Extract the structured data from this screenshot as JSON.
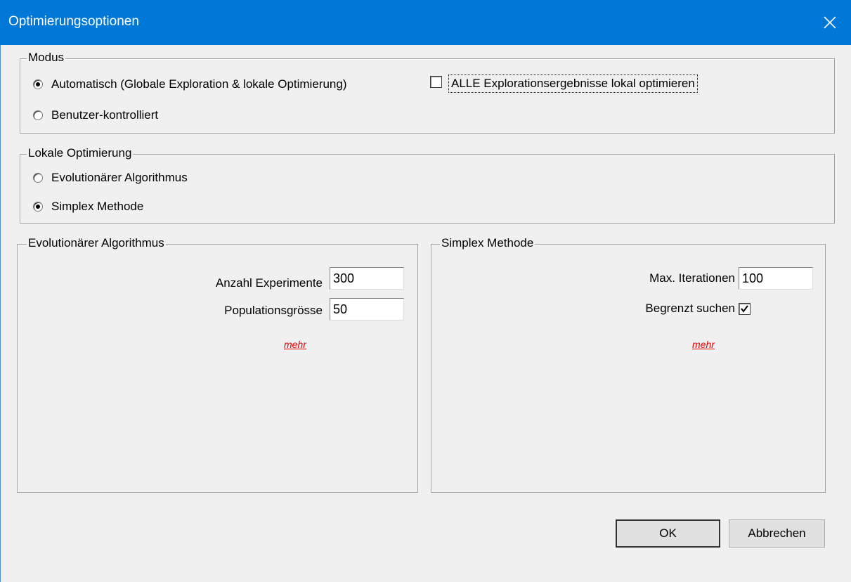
{
  "window": {
    "title": "Optimierungsoptionen",
    "close_glyph": "close-icon"
  },
  "modus": {
    "legend": "Modus",
    "options": [
      {
        "label": "Automatisch (Globale Exploration & lokale Optimierung)",
        "selected": true
      },
      {
        "label": "Benutzer-kontrolliert",
        "selected": false
      }
    ],
    "alle_checkbox": {
      "label": "ALLE Explorationsergebnisse lokal optimieren",
      "checked": false
    }
  },
  "lokale": {
    "legend": "Lokale Optimierung",
    "options": [
      {
        "label": "Evolutionärer Algorithmus",
        "selected": false
      },
      {
        "label": "Simplex Methode",
        "selected": true
      }
    ]
  },
  "evolutionary": {
    "legend": "Evolutionärer Algorithmus",
    "experiments_label": "Anzahl Experimente",
    "experiments_value": "300",
    "population_label": "Populationsgrösse",
    "population_value": "50",
    "more_link": "mehr"
  },
  "simplex": {
    "legend": "Simplex Methode",
    "iterations_label": "Max. Iterationen",
    "iterations_value": "100",
    "bounded_label": "Begrenzt suchen",
    "bounded_checked": true,
    "more_link": "mehr"
  },
  "buttons": {
    "ok": "OK",
    "cancel": "Abbrechen"
  },
  "colors": {
    "titlebar": "#0078d7",
    "link": "#e00000",
    "background": "#f0f0f0"
  }
}
